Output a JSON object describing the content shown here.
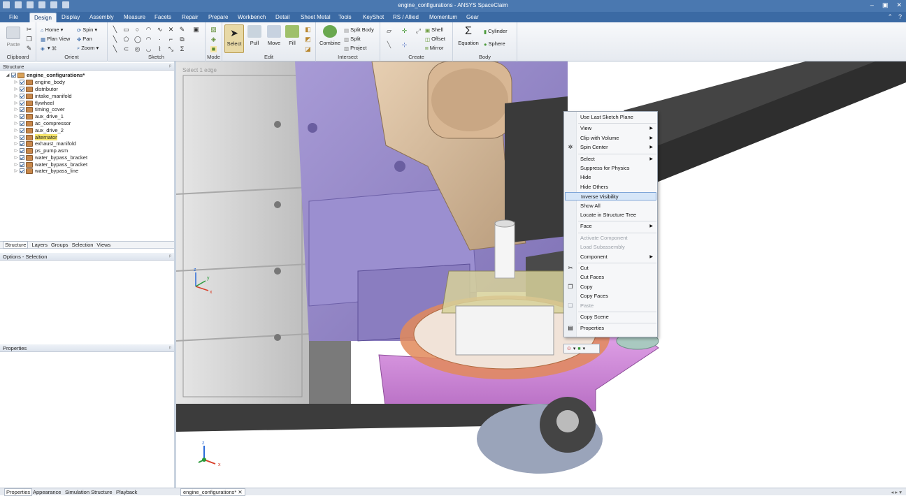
{
  "window": {
    "title": "engine_configurations - ANSYS SpaceClaim",
    "controls": [
      "–",
      "▣",
      "✕"
    ]
  },
  "menu": {
    "file": "File",
    "tabs": [
      "Design",
      "Display",
      "Assembly",
      "Measure",
      "Facets",
      "Repair",
      "Prepare",
      "Workbench",
      "Detail",
      "Sheet Metal",
      "Tools",
      "KeyShot",
      "RS / Allied",
      "Momentum",
      "Gear"
    ],
    "active_tab": "Design",
    "help_icons": [
      "⌃",
      "?"
    ]
  },
  "ribbon": {
    "clipboard": {
      "label": "Clipboard",
      "paste": "Paste"
    },
    "orient": {
      "label": "Orient",
      "home": "Home",
      "spin": "Spin",
      "plan_view": "Plan View",
      "pan": "Pan",
      "zoom": "Zoom"
    },
    "sketch": {
      "label": "Sketch"
    },
    "mode": {
      "label": "Mode"
    },
    "edit": {
      "label": "Edit",
      "select": "Select",
      "pull": "Pull",
      "move": "Move",
      "fill": "Fill"
    },
    "intersect": {
      "label": "Intersect",
      "combine": "Combine",
      "split_body": "Split Body",
      "split": "Split",
      "project": "Project"
    },
    "create": {
      "label": "Create",
      "shell": "Shell",
      "offset": "Offset",
      "mirror": "Mirror"
    },
    "body": {
      "label": "Body",
      "equation": "Equation",
      "cylinder": "Cylinder",
      "sphere": "Sphere"
    }
  },
  "structure_panel": {
    "title": "Structure",
    "root": "engine_configurations*",
    "items": [
      {
        "label": "engine_body",
        "highlight": false
      },
      {
        "label": "distributor",
        "highlight": false
      },
      {
        "label": "intake_manifold",
        "highlight": false
      },
      {
        "label": "flywheel",
        "highlight": false
      },
      {
        "label": "timing_cover",
        "highlight": false
      },
      {
        "label": "aux_drive_1",
        "highlight": false
      },
      {
        "label": "ac_compressor",
        "highlight": false
      },
      {
        "label": "aux_drive_2",
        "highlight": false
      },
      {
        "label": "alternator",
        "highlight": true
      },
      {
        "label": "exhaust_manifold",
        "highlight": false
      },
      {
        "label": "ps_pump.asm",
        "highlight": false
      },
      {
        "label": "water_bypass_bracket",
        "highlight": false
      },
      {
        "label": "water_bypass_bracket",
        "highlight": false
      },
      {
        "label": "water_bypass_line",
        "highlight": false
      }
    ],
    "tabs": [
      "Structure",
      "Layers",
      "Groups",
      "Selection",
      "Views"
    ],
    "active_tab": "Structure"
  },
  "options_panel": {
    "title": "Options - Selection"
  },
  "properties_panel": {
    "title": "Properties"
  },
  "bottom_tabs": [
    "Properties",
    "Appearance",
    "Simulation Structure",
    "Playback"
  ],
  "document_tab": "engine_configurations*",
  "viewport": {
    "hint": "Select 1 edge"
  },
  "context_menu": {
    "items": [
      {
        "label": "Use Last Sketch Plane",
        "submenu": false,
        "disabled": false,
        "selected": false
      },
      {
        "sep": true
      },
      {
        "label": "View",
        "submenu": true,
        "disabled": false,
        "selected": false
      },
      {
        "label": "Clip with Volume",
        "submenu": true,
        "disabled": false,
        "selected": false
      },
      {
        "label": "Spin Center",
        "submenu": true,
        "disabled": false,
        "selected": false,
        "icon": "spin-center-icon"
      },
      {
        "sep": true
      },
      {
        "label": "Select",
        "submenu": true,
        "disabled": false,
        "selected": false
      },
      {
        "label": "Suppress for Physics",
        "submenu": false,
        "disabled": false,
        "selected": false
      },
      {
        "label": "Hide",
        "submenu": false,
        "disabled": false,
        "selected": false
      },
      {
        "label": "Hide Others",
        "submenu": false,
        "disabled": false,
        "selected": false
      },
      {
        "label": "Inverse Visibility",
        "submenu": false,
        "disabled": false,
        "selected": true
      },
      {
        "label": "Show All",
        "submenu": false,
        "disabled": false,
        "selected": false
      },
      {
        "label": "Locate in Structure Tree",
        "submenu": false,
        "disabled": false,
        "selected": false
      },
      {
        "sep": true
      },
      {
        "label": "Face",
        "submenu": true,
        "disabled": false,
        "selected": false
      },
      {
        "sep": true
      },
      {
        "label": "Activate Component",
        "submenu": false,
        "disabled": true,
        "selected": false
      },
      {
        "label": "Load Subassembly",
        "submenu": false,
        "disabled": true,
        "selected": false
      },
      {
        "label": "Component",
        "submenu": true,
        "disabled": false,
        "selected": false
      },
      {
        "sep": true
      },
      {
        "label": "Cut",
        "submenu": false,
        "disabled": false,
        "selected": false,
        "icon": "cut-icon"
      },
      {
        "label": "Cut Faces",
        "submenu": false,
        "disabled": false,
        "selected": false
      },
      {
        "label": "Copy",
        "submenu": false,
        "disabled": false,
        "selected": false,
        "icon": "copy-icon"
      },
      {
        "label": "Copy Faces",
        "submenu": false,
        "disabled": false,
        "selected": false
      },
      {
        "label": "Paste",
        "submenu": false,
        "disabled": true,
        "selected": false,
        "icon": "paste-icon"
      },
      {
        "sep": true
      },
      {
        "label": "Copy Scene",
        "submenu": false,
        "disabled": false,
        "selected": false
      },
      {
        "sep": true
      },
      {
        "label": "Properties",
        "submenu": false,
        "disabled": false,
        "selected": false,
        "icon": "properties-icon"
      }
    ]
  },
  "axis_labels": {
    "x": "x",
    "y": "y",
    "z": "z"
  },
  "colors": {
    "title": "#4a78b0",
    "menubar": "#3b6aa4",
    "selection": "#d6e6f8",
    "highlight": "#f4e36a"
  }
}
